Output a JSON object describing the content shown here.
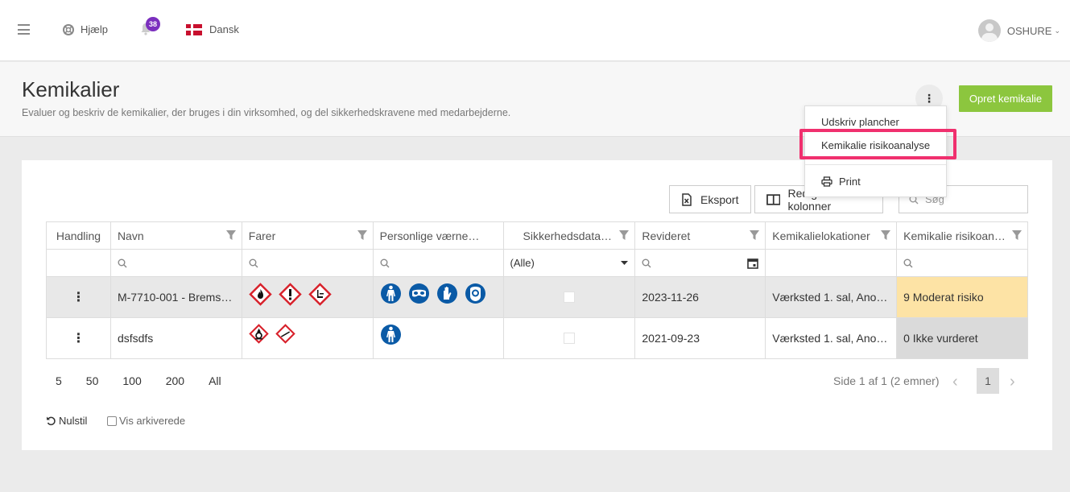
{
  "topbar": {
    "help_label": "Hjælp",
    "notifications_count": "38",
    "language_label": "Dansk",
    "user_name": "OSHURE"
  },
  "header": {
    "title": "Kemikalier",
    "subtitle": "Evaluer og beskriv de kemikalier, der bruges i din virksomhed, og del sikkerhedskravene med medarbejderne.",
    "create_button": "Opret kemikalie"
  },
  "toolbar": {
    "export_label": "Eksport",
    "edit_columns_label": "Rediger kolonner",
    "search_placeholder": "Søg"
  },
  "menu": {
    "items": [
      "Udskriv plancher",
      "Kemikalie risikoanalyse",
      "Print"
    ]
  },
  "grid": {
    "columns": [
      "Handling",
      "Navn",
      "Farer",
      "Personlige værne…",
      "Sikkerhedsdata…",
      "Revideret",
      "Kemikalielokationer",
      "Kemikalie risikoan…"
    ],
    "filter_select_value": "(Alle)",
    "rows": [
      {
        "action": "⋮",
        "name": "M-7710-001 - Brems…",
        "hazards": [
          "flammable-hazard-icon",
          "exclamation-hazard-icon",
          "environment-hazard-icon"
        ],
        "ppe": [
          "protective-suit-icon",
          "goggles-icon",
          "gloves-icon",
          "face-shield-icon"
        ],
        "revised": "2023-11-26",
        "locations": "Værksted 1. sal, Ano…",
        "risk": "9 Moderat risiko",
        "risk_color": "#fde3a5"
      },
      {
        "action": "⋮",
        "name": "dsfsdfs",
        "hazards": [
          "oxidizing-hazard-icon",
          "corrosive-hazard-icon"
        ],
        "ppe": [
          "protective-suit-icon"
        ],
        "revised": "2021-09-23",
        "locations": "Værksted 1. sal, Ano…",
        "risk": "0 Ikke vurderet",
        "risk_color": "#dadada"
      }
    ]
  },
  "pager": {
    "sizes": [
      "5",
      "50",
      "100",
      "200",
      "All"
    ],
    "info": "Side 1 af 1 (2 emner)",
    "current_page": "1"
  },
  "footer": {
    "reset_label": "Nulstil",
    "archived_label": "Vis arkiverede"
  },
  "colors": {
    "accent_green": "#8cc63e",
    "badge_purple": "#7b2fbe",
    "highlight_pink": "#f0306e"
  }
}
